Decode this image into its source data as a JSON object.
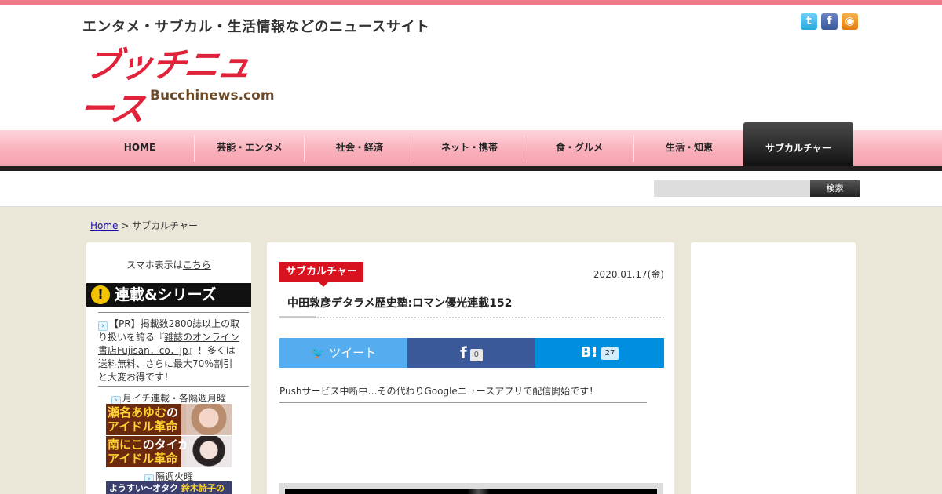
{
  "header": {
    "tagline": "エンタメ・サブカル・生活情報などのニュースサイト",
    "logo_main": "ブッチニュース",
    "logo_sub": "Bucchinews.com",
    "social": {
      "twitter_icon": "twitter-icon",
      "facebook_icon": "facebook-icon",
      "rss_icon": "rss-icon",
      "twitter_glyph": "t",
      "facebook_glyph": "f",
      "rss_glyph": "◉"
    }
  },
  "nav": {
    "items": [
      "HOME",
      "芸能・エンタメ",
      "社会・経済",
      "ネット・携帯",
      "食・グルメ",
      "生活・知恵"
    ],
    "active": "サブカルチャー"
  },
  "search": {
    "button_label": "検索",
    "placeholder": ""
  },
  "breadcrumb": {
    "home": "Home",
    "separator": " > ",
    "current": "サブカルチャー"
  },
  "sidebar": {
    "sp_text": "スマホ表示は",
    "sp_link": "こちら",
    "series_banner": "連載&シリーズ",
    "series_bang": "!",
    "pr_before": "【PR】掲載数2800誌以上の取り扱いを誇る『",
    "pr_link": "雑誌のオンライン書店Fujisan．co．jp",
    "pr_after": "』！多くは送料無料、さらに最大70％割引と大変お得です！",
    "monthly": "月イチ連載・各隔週月曜",
    "banner1_line1_a": "瀬名あゆむ",
    "banner1_line1_b": "の",
    "banner1_line2": "アイドル革命",
    "banner2_line1_a": "南にこ",
    "banner2_line1_b": "のタイから",
    "banner2_line2": "アイドル革命",
    "biweekly": "隔週火曜",
    "banner3_a": "ようすい〜オタク",
    "banner3_b": "鈴木詩子の",
    "arrow_glyph": "›"
  },
  "article": {
    "category": "サブカルチャー",
    "date": "2020.01.17(金)",
    "title": "中田敦彦デタラメ歴史塾:ロマン優光連載152",
    "share": {
      "tweet_label": "ツイート",
      "tweet_glyph": "🐦",
      "facebook_glyph": "f",
      "facebook_count": "0",
      "hatena_glyph": "B!",
      "hatena_count": "27"
    },
    "notice": "Pushサービス中断中…その代わりGoogleニュースアプリで配信開始です！"
  },
  "colors": {
    "accent": "#e0233a",
    "nav_pink": "#f9aeb9",
    "twitter": "#55acee",
    "facebook": "#3b5998",
    "hatena": "#008fde"
  }
}
